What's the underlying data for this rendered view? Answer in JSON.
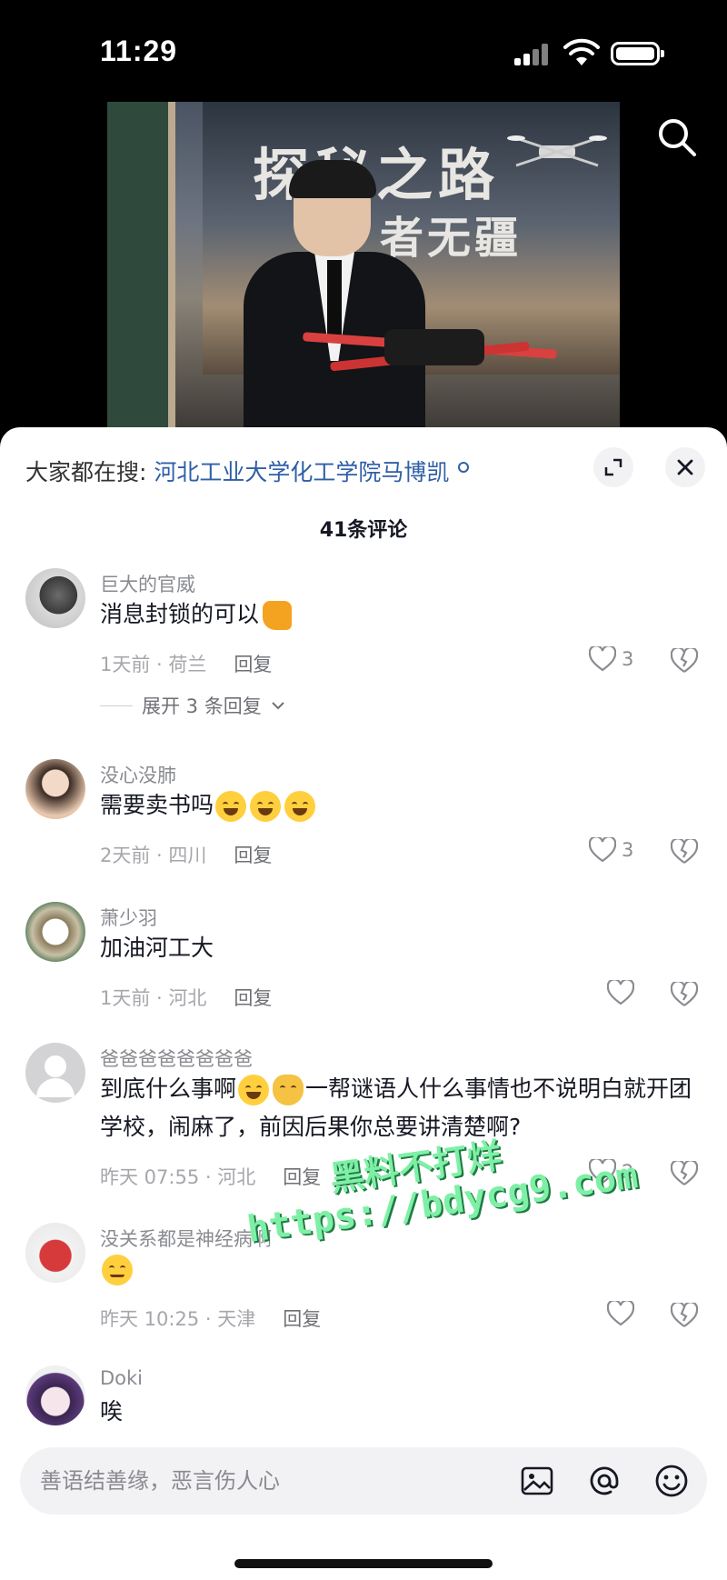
{
  "status_bar": {
    "time": "11:29"
  },
  "header": {
    "hot_search_label": "大家都在搜:",
    "hot_search_term": "河北工业大学化工学院马博凯"
  },
  "video": {
    "poster_title": "探秘之路",
    "poster_subtitle": "者无疆"
  },
  "comments_count": "41条评论",
  "comments": [
    {
      "username": "巨大的官威",
      "text": "消息封锁的可以",
      "time": "1天前 · 荷兰",
      "reply": "回复",
      "likes": "3",
      "expand": "展开 3 条回复"
    },
    {
      "username": "没心没肺",
      "text": "需要卖书吗",
      "time": "2天前 · 四川",
      "reply": "回复",
      "likes": "3"
    },
    {
      "username": "萧少羽",
      "text": "加油河工大",
      "time": "1天前 · 河北",
      "reply": "回复",
      "likes": ""
    },
    {
      "username": "爸爸爸爸爸爸爸爸",
      "text_a": "到底什么事啊",
      "text_b": "一帮谜语人什么事情也不说明白就开团学校，闹麻了，前因后果你总要讲清楚啊?",
      "time": "昨天 07:55 · 河北",
      "reply": "回复",
      "likes": "2"
    },
    {
      "username": "没关系都是神经病啊",
      "text": "",
      "time": "昨天 10:25 · 天津",
      "reply": "回复",
      "likes": ""
    },
    {
      "username": "Doki",
      "text": "唉"
    }
  ],
  "watermark": {
    "line1": "黑料不打烊",
    "line2": "https://bdycg9.com"
  },
  "input": {
    "placeholder": "善语结善缘，恶言伤人心"
  },
  "icons": {
    "search": "search-icon",
    "expand": "expand-icon",
    "close": "close-icon",
    "like": "heart-icon",
    "dislike": "broken-heart-icon",
    "image": "image-icon",
    "mention": "at-icon",
    "emoji": "emoji-icon"
  }
}
